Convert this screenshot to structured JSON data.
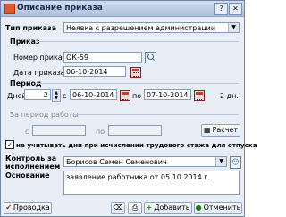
{
  "window": {
    "title": "Описание приказа",
    "controls": {
      "help": "?",
      "close": "✕"
    }
  },
  "order_type": {
    "label": "Тип приказа",
    "value": "Неявка с разрешением администрации"
  },
  "order_section": {
    "heading": "Приказ",
    "number_label": "Номер приказа",
    "number_value": "ОК-59",
    "date_label": "Дата приказа",
    "date_value": "06-10-2014"
  },
  "period": {
    "heading": "Период",
    "days_label": "Дней",
    "days_value": "2",
    "from_label": "с",
    "from_value": "06-10-2014",
    "to_label": "по",
    "to_value": "07-10-2014",
    "summary": "2 дн."
  },
  "work_period": {
    "heading": "За период работы",
    "from_label": "с",
    "to_label": "по",
    "calc_button": "Расчет"
  },
  "exclude_days": {
    "checked": true,
    "label": "не учитывать дни при исчислении трудового стажа для отпуска"
  },
  "control": {
    "label_line1": "Контроль за",
    "label_line2": "исполнением",
    "value": "Борисов Семен Семенович"
  },
  "basis": {
    "label": "Основание",
    "value": "заявление работника от 05.10.2014 г."
  },
  "footer": {
    "post_button": "Проводка",
    "add_button": "Добавить",
    "cancel_button": "Отменить"
  }
}
